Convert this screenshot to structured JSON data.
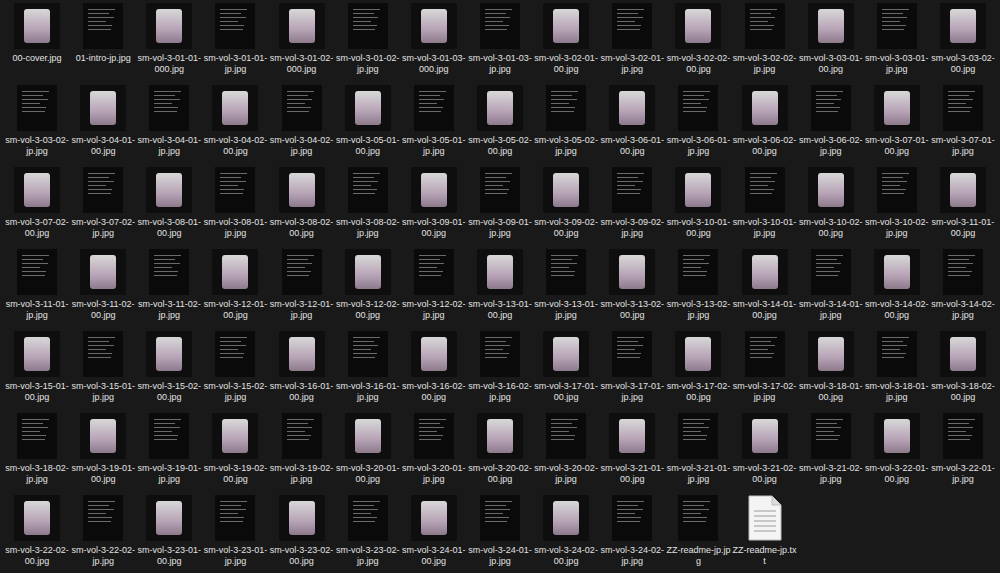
{
  "files": [
    {
      "name": "00-cover.jpg",
      "kind": "picture"
    },
    {
      "name": "01-intro-jp.jpg",
      "kind": "page"
    },
    {
      "name": "sm-vol-3-01-01-000.jpg",
      "kind": "picture"
    },
    {
      "name": "sm-vol-3-01-01-jp.jpg",
      "kind": "page"
    },
    {
      "name": "sm-vol-3-01-02-000.jpg",
      "kind": "picture"
    },
    {
      "name": "sm-vol-3-01-02-jp.jpg",
      "kind": "page"
    },
    {
      "name": "sm-vol-3-01-03-000.jpg",
      "kind": "picture"
    },
    {
      "name": "sm-vol-3-01-03-jp.jpg",
      "kind": "page"
    },
    {
      "name": "sm-vol-3-02-01-00.jpg",
      "kind": "picture"
    },
    {
      "name": "sm-vol-3-02-01-jp.jpg",
      "kind": "page"
    },
    {
      "name": "sm-vol-3-02-02-00.jpg",
      "kind": "picture"
    },
    {
      "name": "sm-vol-3-02-02-jp.jpg",
      "kind": "page"
    },
    {
      "name": "sm-vol-3-03-01-00.jpg",
      "kind": "picture"
    },
    {
      "name": "sm-vol-3-03-01-jp.jpg",
      "kind": "page"
    },
    {
      "name": "sm-vol-3-03-02-00.jpg",
      "kind": "picture"
    },
    {
      "name": "sm-vol-3-03-02-jp.jpg",
      "kind": "page"
    },
    {
      "name": "sm-vol-3-04-01-00.jpg",
      "kind": "picture"
    },
    {
      "name": "sm-vol-3-04-01-jp.jpg",
      "kind": "page"
    },
    {
      "name": "sm-vol-3-04-02-00.jpg",
      "kind": "picture"
    },
    {
      "name": "sm-vol-3-04-02-jp.jpg",
      "kind": "page"
    },
    {
      "name": "sm-vol-3-05-01-00.jpg",
      "kind": "picture"
    },
    {
      "name": "sm-vol-3-05-01-jp.jpg",
      "kind": "page"
    },
    {
      "name": "sm-vol-3-05-02-00.jpg",
      "kind": "picture"
    },
    {
      "name": "sm-vol-3-05-02-jp.jpg",
      "kind": "page"
    },
    {
      "name": "sm-vol-3-06-01-00.jpg",
      "kind": "picture"
    },
    {
      "name": "sm-vol-3-06-01-jp.jpg",
      "kind": "page"
    },
    {
      "name": "sm-vol-3-06-02-00.jpg",
      "kind": "picture"
    },
    {
      "name": "sm-vol-3-06-02-jp.jpg",
      "kind": "page"
    },
    {
      "name": "sm-vol-3-07-01-00.jpg",
      "kind": "picture"
    },
    {
      "name": "sm-vol-3-07-01-jp.jpg",
      "kind": "page"
    },
    {
      "name": "sm-vol-3-07-02-00.jpg",
      "kind": "picture"
    },
    {
      "name": "sm-vol-3-07-02-jp.jpg",
      "kind": "page"
    },
    {
      "name": "sm-vol-3-08-01-00.jpg",
      "kind": "picture"
    },
    {
      "name": "sm-vol-3-08-01-jp.jpg",
      "kind": "page"
    },
    {
      "name": "sm-vol-3-08-02-00.jpg",
      "kind": "picture"
    },
    {
      "name": "sm-vol-3-08-02-jp.jpg",
      "kind": "page"
    },
    {
      "name": "sm-vol-3-09-01-00.jpg",
      "kind": "picture"
    },
    {
      "name": "sm-vol-3-09-01-jp.jpg",
      "kind": "page"
    },
    {
      "name": "sm-vol-3-09-02-00.jpg",
      "kind": "picture"
    },
    {
      "name": "sm-vol-3-09-02-jp.jpg",
      "kind": "page"
    },
    {
      "name": "sm-vol-3-10-01-00.jpg",
      "kind": "picture"
    },
    {
      "name": "sm-vol-3-10-01-jp.jpg",
      "kind": "page"
    },
    {
      "name": "sm-vol-3-10-02-00.jpg",
      "kind": "picture"
    },
    {
      "name": "sm-vol-3-10-02-jp.jpg",
      "kind": "page"
    },
    {
      "name": "sm-vol-3-11-01-00.jpg",
      "kind": "picture"
    },
    {
      "name": "sm-vol-3-11-01-jp.jpg",
      "kind": "page"
    },
    {
      "name": "sm-vol-3-11-02-00.jpg",
      "kind": "picture"
    },
    {
      "name": "sm-vol-3-11-02-jp.jpg",
      "kind": "page"
    },
    {
      "name": "sm-vol-3-12-01-00.jpg",
      "kind": "picture"
    },
    {
      "name": "sm-vol-3-12-01-jp.jpg",
      "kind": "page"
    },
    {
      "name": "sm-vol-3-12-02-00.jpg",
      "kind": "picture"
    },
    {
      "name": "sm-vol-3-12-02-jp.jpg",
      "kind": "page"
    },
    {
      "name": "sm-vol-3-13-01-00.jpg",
      "kind": "picture"
    },
    {
      "name": "sm-vol-3-13-01-jp.jpg",
      "kind": "page"
    },
    {
      "name": "sm-vol-3-13-02-00.jpg",
      "kind": "picture"
    },
    {
      "name": "sm-vol-3-13-02-jp.jpg",
      "kind": "page"
    },
    {
      "name": "sm-vol-3-14-01-00.jpg",
      "kind": "picture"
    },
    {
      "name": "sm-vol-3-14-01-jp.jpg",
      "kind": "page"
    },
    {
      "name": "sm-vol-3-14-02-00.jpg",
      "kind": "picture"
    },
    {
      "name": "sm-vol-3-14-02-jp.jpg",
      "kind": "page"
    },
    {
      "name": "sm-vol-3-15-01-00.jpg",
      "kind": "picture"
    },
    {
      "name": "sm-vol-3-15-01-jp.jpg",
      "kind": "page"
    },
    {
      "name": "sm-vol-3-15-02-00.jpg",
      "kind": "picture"
    },
    {
      "name": "sm-vol-3-15-02-jp.jpg",
      "kind": "page"
    },
    {
      "name": "sm-vol-3-16-01-00.jpg",
      "kind": "picture"
    },
    {
      "name": "sm-vol-3-16-01-jp.jpg",
      "kind": "page"
    },
    {
      "name": "sm-vol-3-16-02-00.jpg",
      "kind": "picture"
    },
    {
      "name": "sm-vol-3-16-02-jp.jpg",
      "kind": "page"
    },
    {
      "name": "sm-vol-3-17-01-00.jpg",
      "kind": "picture"
    },
    {
      "name": "sm-vol-3-17-01-jp.jpg",
      "kind": "page"
    },
    {
      "name": "sm-vol-3-17-02-00.jpg",
      "kind": "picture"
    },
    {
      "name": "sm-vol-3-17-02-jp.jpg",
      "kind": "page"
    },
    {
      "name": "sm-vol-3-18-01-00.jpg",
      "kind": "picture"
    },
    {
      "name": "sm-vol-3-18-01-jp.jpg",
      "kind": "page"
    },
    {
      "name": "sm-vol-3-18-02-00.jpg",
      "kind": "picture"
    },
    {
      "name": "sm-vol-3-18-02-jp.jpg",
      "kind": "page"
    },
    {
      "name": "sm-vol-3-19-01-00.jpg",
      "kind": "picture"
    },
    {
      "name": "sm-vol-3-19-01-jp.jpg",
      "kind": "page"
    },
    {
      "name": "sm-vol-3-19-02-00.jpg",
      "kind": "picture"
    },
    {
      "name": "sm-vol-3-19-02-jp.jpg",
      "kind": "page"
    },
    {
      "name": "sm-vol-3-20-01-00.jpg",
      "kind": "picture"
    },
    {
      "name": "sm-vol-3-20-01-jp.jpg",
      "kind": "page"
    },
    {
      "name": "sm-vol-3-20-02-00.jpg",
      "kind": "picture"
    },
    {
      "name": "sm-vol-3-20-02-jp.jpg",
      "kind": "page"
    },
    {
      "name": "sm-vol-3-21-01-00.jpg",
      "kind": "picture"
    },
    {
      "name": "sm-vol-3-21-01-jp.jpg",
      "kind": "page"
    },
    {
      "name": "sm-vol-3-21-02-00.jpg",
      "kind": "picture"
    },
    {
      "name": "sm-vol-3-21-02-jp.jpg",
      "kind": "page"
    },
    {
      "name": "sm-vol-3-22-01-00.jpg",
      "kind": "picture"
    },
    {
      "name": "sm-vol-3-22-01-jp.jpg",
      "kind": "page"
    },
    {
      "name": "sm-vol-3-22-02-00.jpg",
      "kind": "picture"
    },
    {
      "name": "sm-vol-3-22-02-jp.jpg",
      "kind": "page"
    },
    {
      "name": "sm-vol-3-23-01-00.jpg",
      "kind": "picture"
    },
    {
      "name": "sm-vol-3-23-01-jp.jpg",
      "kind": "page"
    },
    {
      "name": "sm-vol-3-23-02-00.jpg",
      "kind": "picture"
    },
    {
      "name": "sm-vol-3-23-02-jp.jpg",
      "kind": "page"
    },
    {
      "name": "sm-vol-3-24-01-00.jpg",
      "kind": "picture"
    },
    {
      "name": "sm-vol-3-24-01-jp.jpg",
      "kind": "page"
    },
    {
      "name": "sm-vol-3-24-02-00.jpg",
      "kind": "picture"
    },
    {
      "name": "sm-vol-3-24-02-jp.jpg",
      "kind": "page"
    },
    {
      "name": "ZZ-readme-jp.jpg",
      "kind": "page"
    },
    {
      "name": "ZZ-readme-jp.txt",
      "kind": "file"
    }
  ]
}
